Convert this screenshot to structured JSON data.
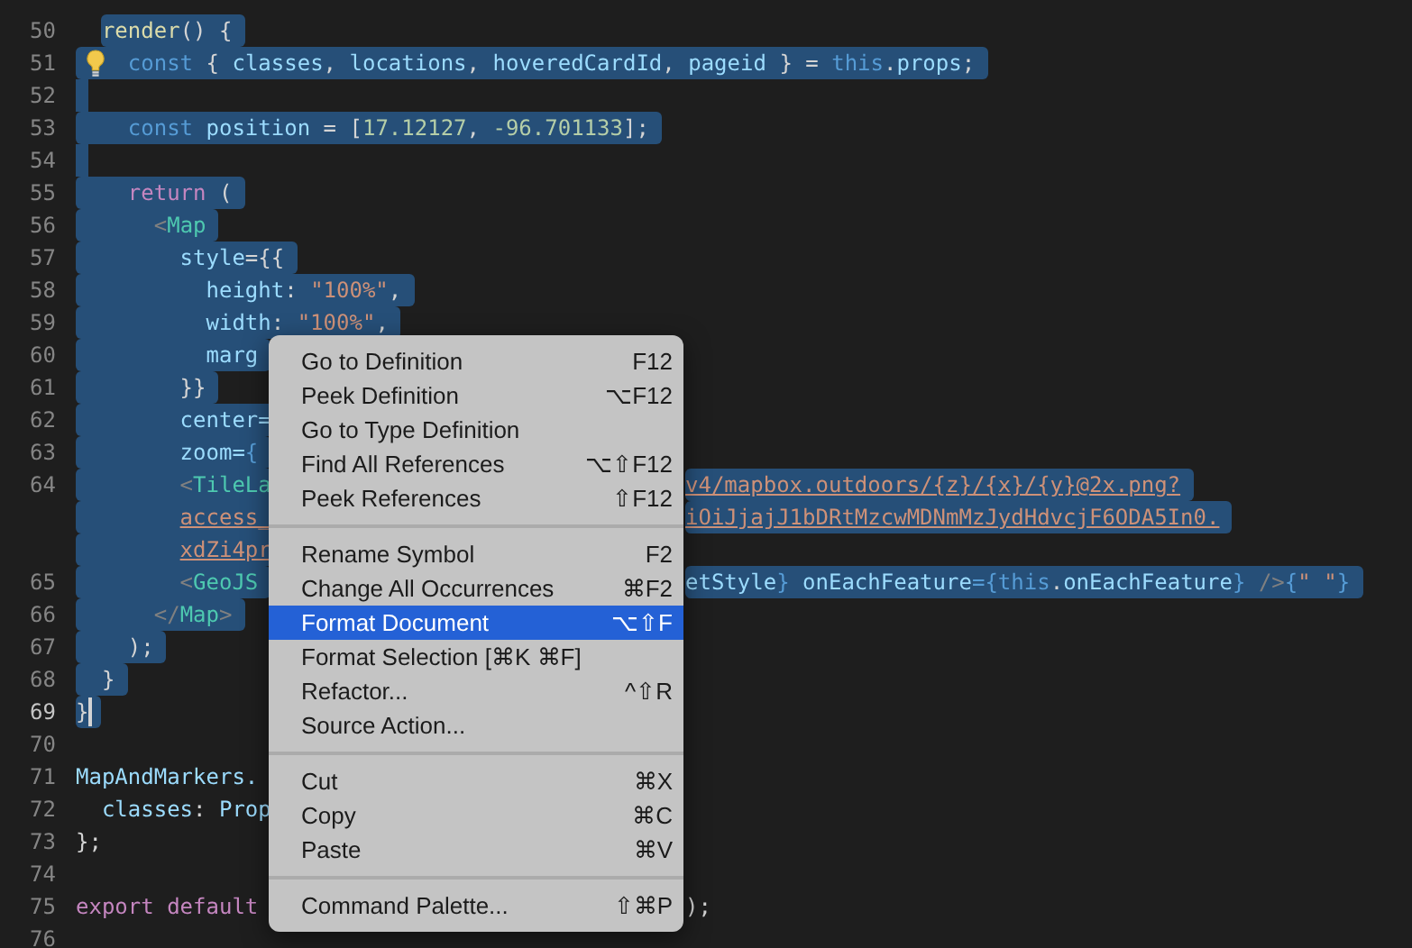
{
  "editor": {
    "lines": [
      {
        "number": "50",
        "current": false,
        "selected": true,
        "segments": [
          [
            {
              "text": "  render",
              "kind": "fn"
            },
            {
              "text": "() {",
              "kind": "p"
            }
          ]
        ]
      },
      {
        "number": "51",
        "current": false,
        "selected": true,
        "hint": true,
        "segments": [
          [
            {
              "text": "    const",
              "kind": "kw"
            },
            {
              "text": " { ",
              "kind": "p"
            },
            {
              "text": "classes",
              "kind": "var"
            },
            {
              "text": ", ",
              "kind": "p"
            },
            {
              "text": "locations",
              "kind": "var"
            },
            {
              "text": ", ",
              "kind": "p"
            },
            {
              "text": "hoveredCardId",
              "kind": "var"
            },
            {
              "text": ", ",
              "kind": "p"
            },
            {
              "text": "pageid",
              "kind": "var"
            },
            {
              "text": " } = ",
              "kind": "p"
            },
            {
              "text": "this",
              "kind": "kw"
            },
            {
              "text": ".",
              "kind": "p"
            },
            {
              "text": "props",
              "kind": "var"
            },
            {
              "text": ";",
              "kind": "p"
            }
          ]
        ]
      },
      {
        "number": "52",
        "current": false,
        "selected": true
      },
      {
        "number": "53",
        "current": false,
        "selected": true,
        "segments": [
          [
            {
              "text": "    const",
              "kind": "kw"
            },
            {
              "text": " position",
              "kind": "var"
            },
            {
              "text": " = [",
              "kind": "p"
            },
            {
              "text": "17.12127",
              "kind": "num"
            },
            {
              "text": ", ",
              "kind": "p"
            },
            {
              "text": "-96.701133",
              "kind": "num"
            },
            {
              "text": "];",
              "kind": "p"
            }
          ]
        ]
      },
      {
        "number": "54",
        "current": false,
        "selected": true
      },
      {
        "number": "55",
        "current": false,
        "selected": true,
        "segments": [
          [
            {
              "text": "    return",
              "kind": "ctl"
            },
            {
              "text": " (",
              "kind": "p"
            }
          ]
        ]
      },
      {
        "number": "56",
        "current": false,
        "selected": true,
        "segments": [
          [
            {
              "text": "      <",
              "kind": "ang"
            },
            {
              "text": "Map",
              "kind": "tag"
            }
          ]
        ]
      },
      {
        "number": "57",
        "current": false,
        "selected": true,
        "segments": [
          [
            {
              "text": "        style",
              "kind": "var"
            },
            {
              "text": "={{",
              "kind": "p"
            }
          ]
        ]
      },
      {
        "number": "58",
        "current": false,
        "selected": true,
        "segments": [
          [
            {
              "text": "          height",
              "kind": "var"
            },
            {
              "text": ": ",
              "kind": "p"
            },
            {
              "text": "\"100%\"",
              "kind": "str"
            },
            {
              "text": ",",
              "kind": "p"
            }
          ]
        ]
      },
      {
        "number": "59",
        "current": false,
        "selected": true,
        "segments": [
          [
            {
              "text": "          width",
              "kind": "var"
            },
            {
              "text": ": ",
              "kind": "p"
            },
            {
              "text": "\"100%\"",
              "kind": "str"
            },
            {
              "text": ",",
              "kind": "p"
            }
          ]
        ]
      },
      {
        "number": "60",
        "current": false,
        "selected": true,
        "segments": [
          [
            {
              "text": "          marg",
              "kind": "var"
            }
          ]
        ]
      },
      {
        "number": "61",
        "current": false,
        "selected": true,
        "segments": [
          [
            {
              "text": "        }}",
              "kind": "p"
            }
          ]
        ]
      },
      {
        "number": "62",
        "current": false,
        "selected": true,
        "segments": [
          [
            {
              "text": "        center=",
              "kind": "var"
            }
          ]
        ]
      },
      {
        "number": "63",
        "current": false,
        "selected": true,
        "segments": [
          [
            {
              "text": "        zoom=",
              "kind": "var"
            },
            {
              "text": "{",
              "kind": "kw"
            }
          ]
        ]
      },
      {
        "number": "64",
        "current": false,
        "selected": true,
        "segments": [
          [
            {
              "text": "        <",
              "kind": "ang"
            },
            {
              "text": "TileLa",
              "kind": "tag"
            }
          ],
          [
            {
              "text": "v4/mapbox.outdoors/{z}/{x}/{y}@2x.png?",
              "kind": "url"
            }
          ]
        ]
      },
      {
        "selected": true,
        "segments": [
          [
            {
              "text": "        access_",
              "kind": "url"
            }
          ],
          [
            {
              "text": "iOiJjajJ1bDRtMzcwMDNmMzJydHdvcjF6ODA5In0.",
              "kind": "url"
            }
          ]
        ]
      },
      {
        "selected": true,
        "segments": [
          [
            {
              "text": "        xdZi4pr",
              "kind": "url"
            }
          ]
        ]
      },
      {
        "number": "65",
        "current": false,
        "selected": true,
        "segments": [
          [
            {
              "text": "        <",
              "kind": "ang"
            },
            {
              "text": "GeoJS",
              "kind": "tag"
            }
          ],
          [
            {
              "text": "etStyle",
              "kind": "var"
            },
            {
              "text": "}",
              "kind": "kw"
            },
            {
              "text": " onEachFeature",
              "kind": "var"
            },
            {
              "text": "={",
              "kind": "kw"
            },
            {
              "text": "this",
              "kind": "kw"
            },
            {
              "text": ".",
              "kind": "p"
            },
            {
              "text": "onEachFeature",
              "kind": "var"
            },
            {
              "text": "}",
              "kind": "kw"
            },
            {
              "text": " />",
              "kind": "ang"
            },
            {
              "text": "{",
              "kind": "kw"
            },
            {
              "text": "\" \"",
              "kind": "str"
            },
            {
              "text": "}",
              "kind": "kw"
            }
          ]
        ]
      },
      {
        "number": "66",
        "current": false,
        "selected": true,
        "segments": [
          [
            {
              "text": "      </",
              "kind": "ang"
            },
            {
              "text": "Map",
              "kind": "tag"
            },
            {
              "text": ">",
              "kind": "ang"
            }
          ]
        ]
      },
      {
        "number": "67",
        "current": false,
        "selected": true,
        "segments": [
          [
            {
              "text": "    );",
              "kind": "p"
            }
          ]
        ]
      },
      {
        "number": "68",
        "current": false,
        "selected": true,
        "segments": [
          [
            {
              "text": "  }",
              "kind": "p"
            }
          ]
        ]
      },
      {
        "number": "69",
        "current": true,
        "selected": true,
        "segments": [
          [
            {
              "text": "}",
              "kind": "p"
            }
          ]
        ]
      },
      {
        "number": "70",
        "current": false,
        "selected": false
      },
      {
        "number": "71",
        "current": false,
        "selected": false,
        "segments": [
          [
            {
              "text": "MapAndMarkers.",
              "kind": "var"
            }
          ]
        ]
      },
      {
        "number": "72",
        "current": false,
        "selected": false,
        "segments": [
          [
            {
              "text": "  classes",
              "kind": "var"
            },
            {
              "text": ": ",
              "kind": "p"
            },
            {
              "text": "Prop",
              "kind": "var"
            }
          ]
        ]
      },
      {
        "number": "73",
        "current": false,
        "selected": false,
        "segments": [
          [
            {
              "text": "};",
              "kind": "p"
            }
          ]
        ]
      },
      {
        "number": "74",
        "current": false,
        "selected": false
      },
      {
        "number": "75",
        "current": false,
        "selected": false,
        "segments": [
          [
            {
              "text": "export default",
              "kind": "ctl"
            }
          ],
          [
            {
              "text": ");",
              "kind": "p"
            }
          ]
        ]
      },
      {
        "number": "76",
        "current": false,
        "selected": false
      }
    ]
  },
  "context_menu": {
    "groups": [
      [
        {
          "label": "Go to Definition",
          "shortcut": "F12",
          "selected": false
        },
        {
          "label": "Peek Definition",
          "shortcut": "⌥F12",
          "selected": false
        },
        {
          "label": "Go to Type Definition",
          "selected": false
        },
        {
          "label": "Find All References",
          "shortcut": "⌥⇧F12",
          "selected": false
        },
        {
          "label": "Peek References",
          "shortcut": "⇧F12",
          "selected": false
        }
      ],
      [
        {
          "label": "Rename Symbol",
          "shortcut": "F2",
          "selected": false
        },
        {
          "label": "Change All Occurrences",
          "shortcut": "⌘F2",
          "selected": false
        },
        {
          "label": "Format Document",
          "shortcut": "⌥⇧F",
          "selected": true
        },
        {
          "label": "Format Selection [⌘K ⌘F]",
          "selected": false
        },
        {
          "label": "Refactor...",
          "shortcut": "^⇧R",
          "selected": false
        },
        {
          "label": "Source Action...",
          "selected": false
        }
      ],
      [
        {
          "label": "Cut",
          "shortcut": "⌘X",
          "selected": false
        },
        {
          "label": "Copy",
          "shortcut": "⌘C",
          "selected": false
        },
        {
          "label": "Paste",
          "shortcut": "⌘V",
          "selected": false
        }
      ],
      [
        {
          "label": "Command Palette...",
          "shortcut": "⇧⌘P",
          "selected": false
        }
      ]
    ]
  }
}
